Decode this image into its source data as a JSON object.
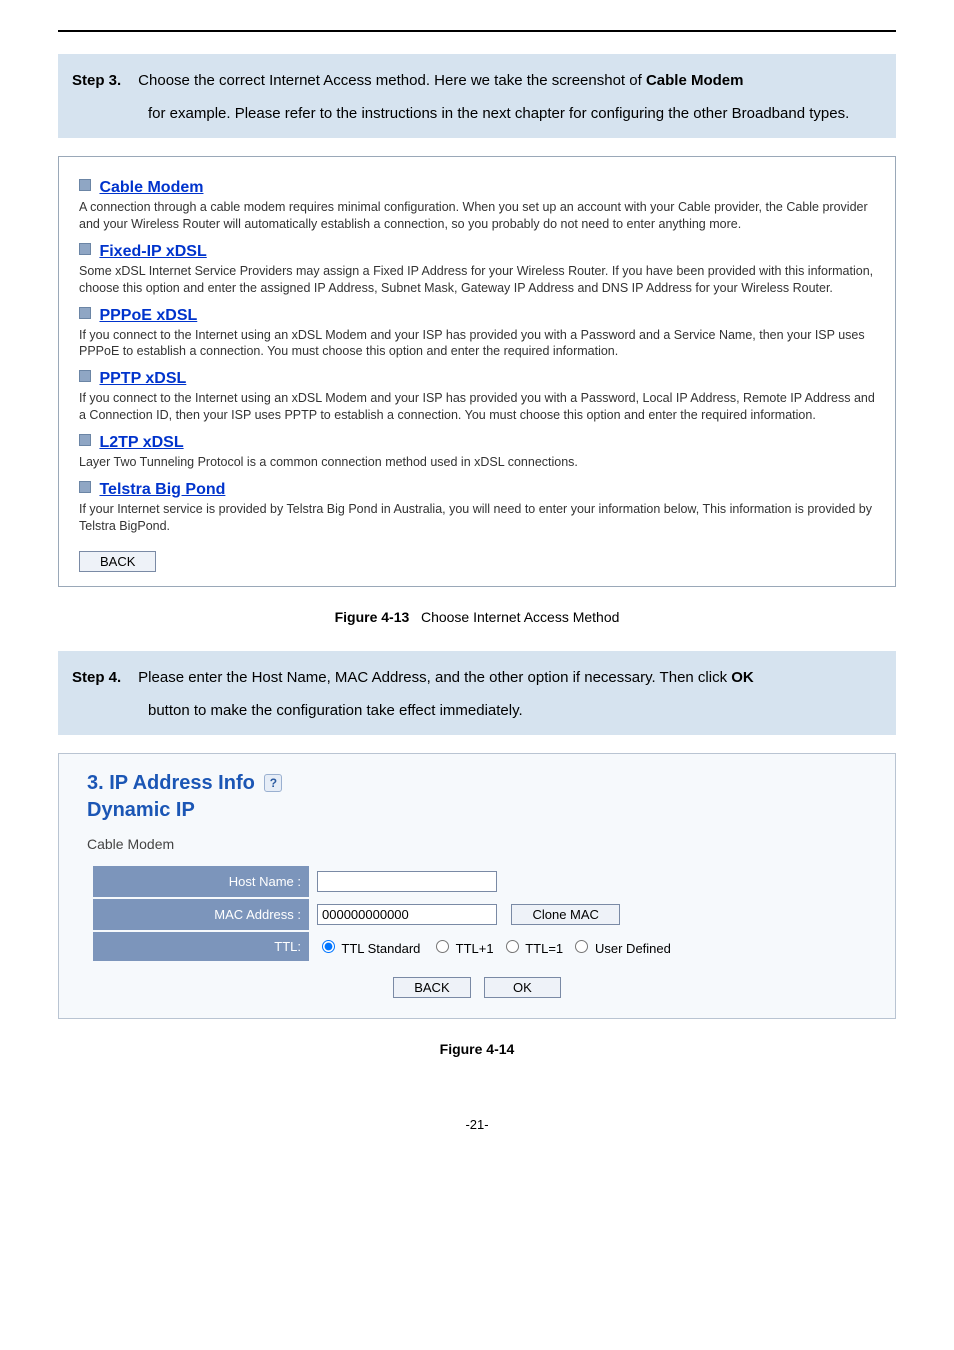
{
  "step3": {
    "label": "Step 3.",
    "line1": "Choose the correct Internet Access method. Here we take the screenshot of ",
    "line1_bold": "Cable Modem",
    "body": "for example. Please refer to the instructions in the next chapter for configuring the other Broadband types."
  },
  "panel_options": {
    "cable": {
      "title": "Cable Modem",
      "desc": "A connection through a cable modem requires minimal configuration. When you set up an account with your Cable provider, the Cable provider and your Wireless Router will automatically establish a connection, so you probably do not need to enter anything more."
    },
    "fixed": {
      "title": "Fixed-IP xDSL",
      "desc": "Some xDSL Internet Service Providers may assign a Fixed IP Address for your Wireless Router. If you have been provided with this information, choose this option and enter the assigned IP Address, Subnet Mask, Gateway IP Address and DNS IP Address for your Wireless Router."
    },
    "pppoe": {
      "title": "PPPoE xDSL",
      "desc": "If you connect to the Internet using an xDSL Modem and your ISP has provided you with a Password and a Service Name, then your ISP uses PPPoE to establish a connection. You must choose this option and enter the required information."
    },
    "pptp": {
      "title": "PPTP xDSL",
      "desc": "If you connect to the Internet using an xDSL Modem and your ISP has provided you with a Password, Local IP Address, Remote IP Address and a Connection ID, then your ISP uses PPTP to establish a connection. You must choose this option and enter the required information."
    },
    "l2tp": {
      "title": "L2TP xDSL",
      "desc": "Layer Two Tunneling Protocol is a common connection method used in xDSL connections."
    },
    "telstra": {
      "title": "Telstra Big Pond",
      "desc": "If your Internet service is provided by Telstra Big Pond in Australia, you will need to enter your information below, This information is provided by Telstra BigPond."
    },
    "back": "BACK"
  },
  "fig413": {
    "label": "Figure 4-13",
    "text": "Choose Internet Access Method"
  },
  "step4": {
    "label": "Step 4.",
    "line1": "Please enter the Host Name, MAC Address, and the other option if necessary. Then click ",
    "line1_bold": "OK",
    "body": "button to make the configuration take effect immediately."
  },
  "form": {
    "title": "3. IP Address Info",
    "subtitle": "Dynamic IP",
    "cable": "Cable Modem",
    "host_label": "Host Name :",
    "host_value": "",
    "mac_label": "MAC Address :",
    "mac_value": "000000000000",
    "clone_btn": "Clone MAC",
    "ttl_label": "TTL:",
    "ttl": {
      "std": "TTL Standard",
      "p1": "TTL+1",
      "e1": "TTL=1",
      "ud": "User Defined"
    },
    "back": "BACK",
    "ok": "OK"
  },
  "fig414": {
    "label": "Figure 4-14"
  },
  "page_number": "-21-"
}
